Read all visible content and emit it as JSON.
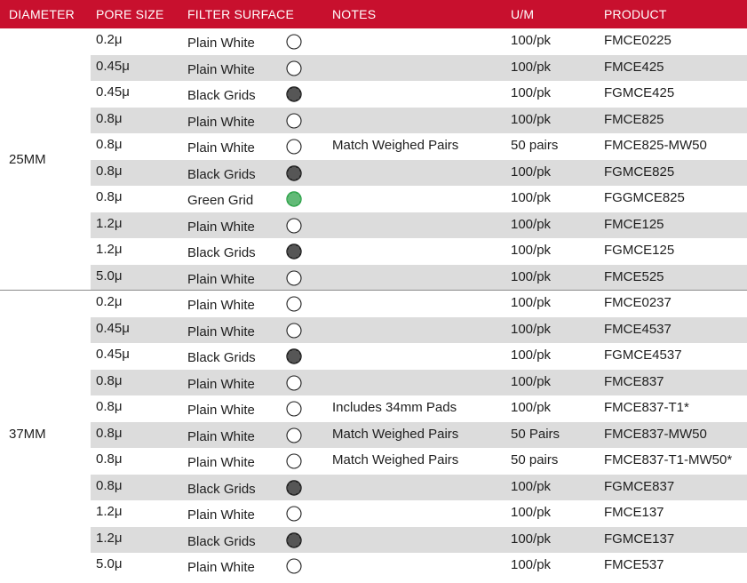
{
  "header": {
    "diameter": "DIAMETER",
    "pore_size": "PORE SIZE",
    "filter_surface": "FILTER SURFACE",
    "notes": "NOTES",
    "um": "U/M",
    "product": "PRODUCT"
  },
  "colors": {
    "header_bg": "#c8102e",
    "row_shade": "#dcdcdc",
    "black_grid": "#1e1e1e",
    "green_grid": "#2ea34a"
  },
  "groups": [
    {
      "diameter": "25MM",
      "rows": [
        {
          "pore": "0.2μ",
          "surface": "Plain White",
          "icon": "plain-circle-icon",
          "notes": "",
          "um": "100/pk",
          "product": "FMCE0225"
        },
        {
          "pore": "0.45μ",
          "surface": "Plain White",
          "icon": "plain-circle-icon",
          "notes": "",
          "um": "100/pk",
          "product": "FMCE425"
        },
        {
          "pore": "0.45μ",
          "surface": "Black Grids",
          "icon": "black-grid-icon",
          "notes": "",
          "um": "100/pk",
          "product": "FGMCE425"
        },
        {
          "pore": "0.8μ",
          "surface": "Plain White",
          "icon": "plain-circle-icon",
          "notes": "",
          "um": "100/pk",
          "product": "FMCE825"
        },
        {
          "pore": "0.8μ",
          "surface": "Plain White",
          "icon": "plain-circle-icon",
          "notes": "Match Weighed Pairs",
          "um": "50 pairs",
          "product": "FMCE825-MW50"
        },
        {
          "pore": "0.8μ",
          "surface": "Black Grids",
          "icon": "black-grid-icon",
          "notes": "",
          "um": "100/pk",
          "product": "FGMCE825"
        },
        {
          "pore": "0.8μ",
          "surface": "Green Grid",
          "icon": "green-grid-icon",
          "notes": "",
          "um": "100/pk",
          "product": "FGGMCE825"
        },
        {
          "pore": "1.2μ",
          "surface": "Plain White",
          "icon": "plain-circle-icon",
          "notes": "",
          "um": "100/pk",
          "product": "FMCE125"
        },
        {
          "pore": "1.2μ",
          "surface": "Black Grids",
          "icon": "black-grid-icon",
          "notes": "",
          "um": "100/pk",
          "product": "FGMCE125"
        },
        {
          "pore": "5.0μ",
          "surface": "Plain White",
          "icon": "plain-circle-icon",
          "notes": "",
          "um": "100/pk",
          "product": "FMCE525"
        }
      ]
    },
    {
      "diameter": "37MM",
      "rows": [
        {
          "pore": "0.2μ",
          "surface": "Plain White",
          "icon": "plain-circle-icon",
          "notes": "",
          "um": "100/pk",
          "product": "FMCE0237"
        },
        {
          "pore": "0.45μ",
          "surface": "Plain White",
          "icon": "plain-circle-icon",
          "notes": "",
          "um": "100/pk",
          "product": "FMCE4537"
        },
        {
          "pore": "0.45μ",
          "surface": "Black Grids",
          "icon": "black-grid-icon",
          "notes": "",
          "um": "100/pk",
          "product": "FGMCE4537"
        },
        {
          "pore": "0.8μ",
          "surface": "Plain White",
          "icon": "plain-circle-icon",
          "notes": "",
          "um": "100/pk",
          "product": "FMCE837"
        },
        {
          "pore": "0.8μ",
          "surface": "Plain White",
          "icon": "plain-circle-icon",
          "notes": "Includes 34mm Pads",
          "um": "100/pk",
          "product": "FMCE837-T1*"
        },
        {
          "pore": "0.8μ",
          "surface": "Plain White",
          "icon": "plain-circle-icon",
          "notes": "Match Weighed Pairs",
          "um": "50 Pairs",
          "product": "FMCE837-MW50"
        },
        {
          "pore": "0.8μ",
          "surface": "Plain White",
          "icon": "plain-circle-icon",
          "notes": "Match Weighed Pairs",
          "um": "50 pairs",
          "product": "FMCE837-T1-MW50*"
        },
        {
          "pore": "0.8μ",
          "surface": "Black Grids",
          "icon": "black-grid-icon",
          "notes": "",
          "um": "100/pk",
          "product": "FGMCE837"
        },
        {
          "pore": "1.2μ",
          "surface": "Plain White",
          "icon": "plain-circle-icon",
          "notes": "",
          "um": "100/pk",
          "product": "FMCE137"
        },
        {
          "pore": "1.2μ",
          "surface": "Black Grids",
          "icon": "black-grid-icon",
          "notes": "",
          "um": "100/pk",
          "product": "FGMCE137"
        },
        {
          "pore": "5.0μ",
          "surface": "Plain White",
          "icon": "plain-circle-icon",
          "notes": "",
          "um": "100/pk",
          "product": "FMCE537"
        }
      ]
    }
  ]
}
